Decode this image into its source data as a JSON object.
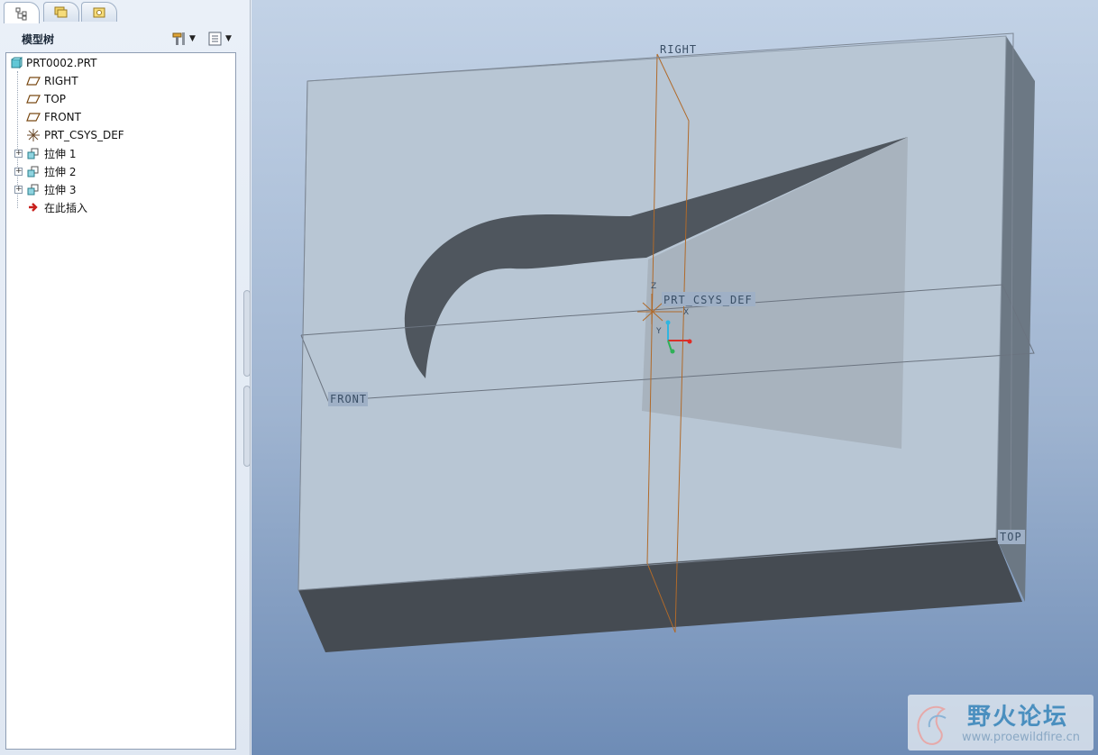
{
  "navigator": {
    "tabs": [
      {
        "name": "model-tree-tab",
        "icon": "model-tree-icon",
        "active": true
      },
      {
        "name": "folder-browser-tab",
        "icon": "folder-stack-icon",
        "active": false
      },
      {
        "name": "favorites-tab",
        "icon": "favorites-icon",
        "active": false
      }
    ],
    "header": {
      "title": "模型树",
      "settings_icon": "tools-icon",
      "show_icon": "list-icon"
    },
    "tree": {
      "root": "PRT0002.PRT",
      "items": [
        {
          "label": "RIGHT",
          "icon": "datum-plane-icon",
          "expandable": false
        },
        {
          "label": "TOP",
          "icon": "datum-plane-icon",
          "expandable": false
        },
        {
          "label": "FRONT",
          "icon": "datum-plane-icon",
          "expandable": false
        },
        {
          "label": "PRT_CSYS_DEF",
          "icon": "coordinate-system-icon",
          "expandable": false
        },
        {
          "label": "拉伸 1",
          "icon": "extrude-icon",
          "expandable": true
        },
        {
          "label": "拉伸 2",
          "icon": "extrude-icon",
          "expandable": true
        },
        {
          "label": "拉伸 3",
          "icon": "extrude-icon",
          "expandable": true
        },
        {
          "label": "在此插入",
          "icon": "insert-here-arrow-icon",
          "expandable": false
        }
      ]
    }
  },
  "viewport": {
    "labels": {
      "right": "RIGHT",
      "front": "FRONT",
      "top": "TOP",
      "csys": "PRT_CSYS_DEF",
      "axis_x": "X",
      "axis_y": "Y",
      "axis_z": "Z"
    },
    "colors": {
      "datum_plane_edge": "#b06a2a",
      "block_face": "#b7c5d2",
      "block_bottom": "#454b52"
    }
  },
  "watermark": {
    "title": "野火论坛",
    "url": "www.proewildfire.cn"
  }
}
